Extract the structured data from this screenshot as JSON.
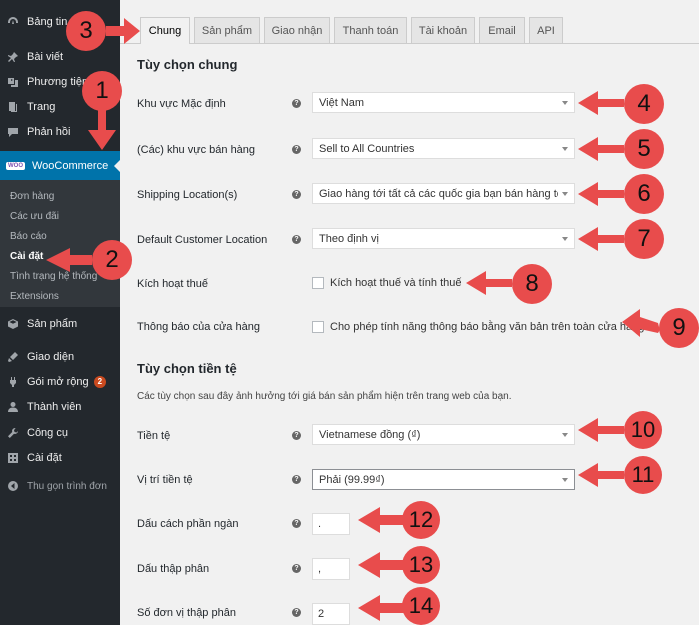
{
  "sidebar": {
    "items": [
      {
        "label": "Bảng tin",
        "icon": "dashboard-icon"
      },
      {
        "label": "Bài viết",
        "icon": "pin-icon"
      },
      {
        "label": "Phương tiện",
        "icon": "media-icon"
      },
      {
        "label": "Trang",
        "icon": "page-icon"
      },
      {
        "label": "Phản hồi",
        "icon": "comment-icon"
      },
      {
        "label": "WooCommerce",
        "icon": "woo-icon"
      },
      {
        "label": "Sản phẩm",
        "icon": "product-icon"
      },
      {
        "label": "Giao diện",
        "icon": "appearance-icon"
      },
      {
        "label": "Gói mở rộng",
        "icon": "plugin-icon",
        "badge": "2"
      },
      {
        "label": "Thành viên",
        "icon": "user-icon"
      },
      {
        "label": "Công cụ",
        "icon": "tools-icon"
      },
      {
        "label": "Cài đặt",
        "icon": "settings-icon"
      },
      {
        "label": "Thu gọn trình đơn",
        "icon": "collapse-icon"
      }
    ],
    "woo_logo_text": "WOO",
    "submenu": [
      "Đơn hàng",
      "Các ưu đãi",
      "Báo cáo",
      "Cài đặt",
      "Tình trạng hệ thống",
      "Extensions"
    ]
  },
  "tabs": [
    "Chung",
    "Sản phẩm",
    "Giao nhận",
    "Thanh toán",
    "Tài khoản",
    "Email",
    "API"
  ],
  "general": {
    "heading": "Tùy chọn chung",
    "base_location": {
      "label": "Khu vực Mặc định",
      "value": "Việt Nam"
    },
    "selling_location": {
      "label": "(Các) khu vực bán hàng",
      "value": "Sell to All Countries"
    },
    "shipping_location": {
      "label": "Shipping Location(s)",
      "value": "Giao hàng tới tất cả các quốc gia bạn bán hàng tới"
    },
    "customer_location": {
      "label": "Default Customer Location",
      "value": "Theo định vị"
    },
    "enable_taxes": {
      "label": "Kích hoạt thuế",
      "checkbox_label": "Kích hoạt thuế và tính thuế"
    },
    "store_notice": {
      "label": "Thông báo của cửa hàng",
      "checkbox_label": "Cho phép tính năng thông báo bằng văn bản trên toàn cửa hàng"
    }
  },
  "currency": {
    "heading": "Tùy chọn tiền tệ",
    "description": "Các tùy chọn sau đây ảnh hưởng tới giá bán sản phẩm hiện trên trang web của bạn.",
    "currency": {
      "label": "Tiền tệ",
      "value": "Vietnamese đồng (₫)"
    },
    "position": {
      "label": "Vị trí tiền tệ",
      "value": "Phải (99.99₫)"
    },
    "thousand_sep": {
      "label": "Dấu cách phần ngàn",
      "value": "."
    },
    "decimal_sep": {
      "label": "Dấu thập phân",
      "value": ","
    },
    "decimals": {
      "label": "Số đơn vị thập phân",
      "value": "2"
    }
  },
  "help_glyph": "?",
  "callouts": [
    "1",
    "2",
    "3",
    "4",
    "5",
    "6",
    "7",
    "8",
    "9",
    "10",
    "11",
    "12",
    "13",
    "14"
  ],
  "colors": {
    "sidebar_bg": "#23282d",
    "submenu_bg": "#32373c",
    "active_blue": "#0073aa",
    "callout_red": "#e84c4c",
    "badge": "#ca4a1f"
  }
}
